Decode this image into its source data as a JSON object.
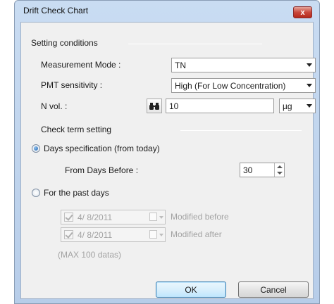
{
  "window": {
    "title": "Drift Check Chart",
    "close_glyph": "x"
  },
  "setting_conditions": {
    "group_label": "Setting conditions",
    "measurement_mode": {
      "label": "Measurement Mode :",
      "value": "TN"
    },
    "pmt_sensitivity": {
      "label": "PMT sensitivity :",
      "value": "High (For Low Concentration)"
    },
    "n_vol": {
      "label": "N vol. :",
      "value": "10",
      "unit": "µg",
      "search_icon": "binoculars-icon"
    }
  },
  "check_term": {
    "group_label": "Check term setting",
    "days_spec": {
      "label": "Days specification (from today)",
      "checked": true
    },
    "from_days": {
      "label": "From Days Before :",
      "value": "30"
    },
    "past_days": {
      "label": "For the past days",
      "checked": false
    },
    "date_before": {
      "value": "4/  8/2011",
      "label": "Modified before"
    },
    "date_after": {
      "value": "4/  8/2011",
      "label": "Modified after"
    },
    "max_note": "(MAX 100 datas)"
  },
  "buttons": {
    "ok": "OK",
    "cancel": "Cancel"
  },
  "colors": {
    "title_bar": "#c9dcf2",
    "close": "#c9473a",
    "client": "#f0f0f0"
  }
}
